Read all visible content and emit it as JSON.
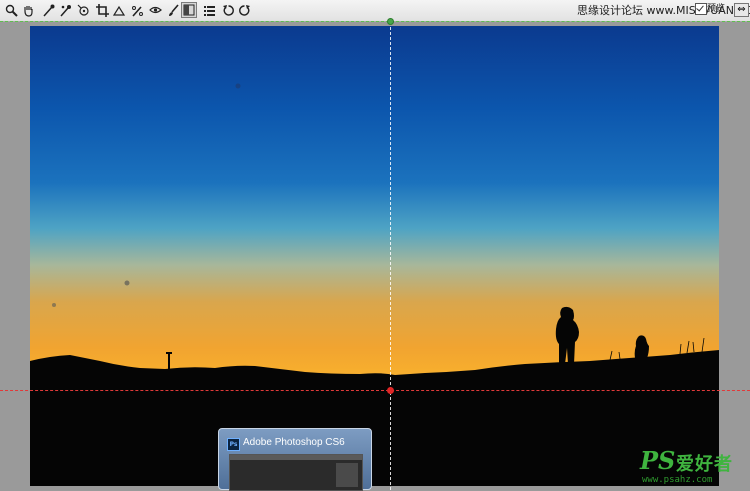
{
  "toolbar": {
    "tools": [
      {
        "name": "zoom-tool-icon",
        "glyph": "🔍"
      },
      {
        "name": "hand-tool-icon",
        "glyph": "✋"
      },
      {
        "name": "white-balance-tool-icon",
        "glyph": "✒"
      },
      {
        "name": "color-sampler-tool-icon",
        "glyph": "✒"
      },
      {
        "name": "targeted-adjustment-tool-icon",
        "glyph": "◎"
      },
      {
        "name": "crop-tool-icon",
        "glyph": "⌗"
      },
      {
        "name": "straighten-tool-icon",
        "glyph": "◺"
      },
      {
        "name": "spot-removal-tool-icon",
        "glyph": "✎"
      },
      {
        "name": "red-eye-removal-tool-icon",
        "glyph": "◉"
      },
      {
        "name": "adjustment-brush-tool-icon",
        "glyph": "✍"
      },
      {
        "name": "graduated-filter-tool-icon",
        "glyph": "▤"
      },
      {
        "name": "preferences-icon",
        "glyph": "☰"
      },
      {
        "name": "rotate-ccw-icon",
        "glyph": "↺"
      },
      {
        "name": "rotate-cw-icon",
        "glyph": "↻"
      }
    ],
    "site_credit": "思缘设计论坛 www.MISSVUAN.COM",
    "preview_label": "预览",
    "preview_checked": true,
    "fullscreen_glyph": "⇔"
  },
  "taskbar_preview": {
    "icon_text": "Ps",
    "title": "Adobe Photoshop CS6"
  },
  "watermark": {
    "logo_ps": "PS",
    "logo_cn": "爱好者",
    "url": "www.psahz.com"
  }
}
